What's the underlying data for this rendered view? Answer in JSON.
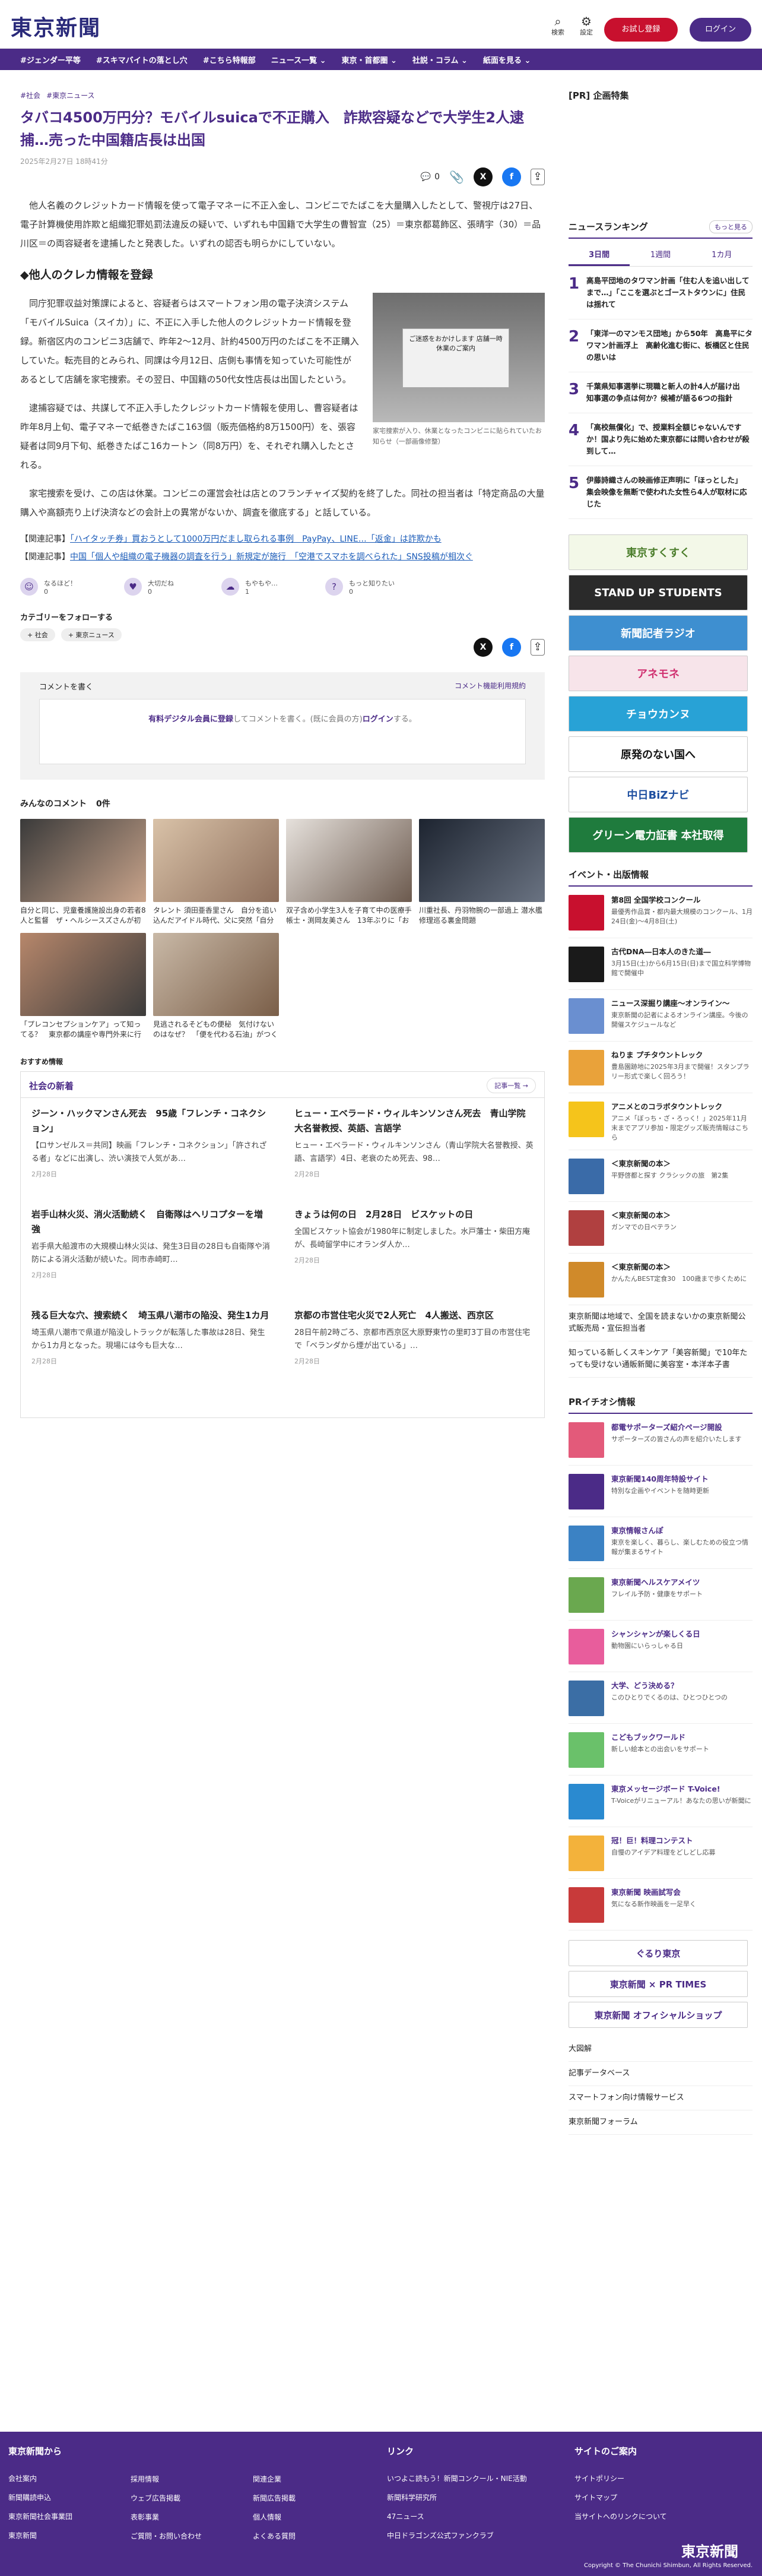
{
  "header": {
    "logo": "東京新聞",
    "search_label": "検索",
    "settings_label": "設定",
    "trial_label": "お試し登録",
    "login_label": "ログイン"
  },
  "nav": [
    "#ジェンダー平等",
    "#スキマバイトの落とし穴",
    "#こちら特報部",
    "ニュース一覧 ⌄",
    "東京・首都圏 ⌄",
    "社説・コラム ⌄",
    "紙面を見る ⌄"
  ],
  "article": {
    "tags": [
      "#社会",
      "#東京ニュース"
    ],
    "title": "タバコ4500万円分？モバイルsuicaで不正購入　詐欺容疑などで大学生2人逮捕…売った中国籍店長は出国",
    "date": "2025年2月27日 18時41分",
    "comment_count": "0",
    "lead": "他人名義のクレジットカード情報を使って電子マネーに不正入金し、コンビニでたばこを大量購入したとして、警視庁は27日、電子計算機使用詐欺と組織犯罪処罰法違反の疑いで、いずれも中国籍で大学生の曹智宣（25）＝東京都葛飾区、張晴宇（30）＝品川区＝の両容疑者を逮捕したと発表した。いずれの認否も明らかにしていない。",
    "h2": "◆他人のクレカ情報を登録",
    "p1": "同庁犯罪収益対策課によると、容疑者らはスマートフォン用の電子決済システム「モバイルSuica（スイカ）」に、不正に入手した他人のクレジットカード情報を登録。新宿区内のコンビニ3店舗で、昨年2～12月、計約4500万円のたばこを不正購入していた。転売目的とみられ、同課は今月12日、店側も事情を知っていた可能性があるとして店舗を家宅捜索。その翌日、中国籍の50代女性店長は出国したという。",
    "p2": "逮捕容疑では、共謀して不正入手したクレジットカード情報を使用し、曹容疑者は昨年8月上旬、電子マネーで紙巻きたばこ163個（販売価格約8万1500円）を、張容疑者は同9月下旬、紙巻きたばこ16カートン（同8万円）を、それぞれ購入したとされる。",
    "p3": "家宅捜索を受け、この店は休業。コンビニの運営会社は店とのフランチャイズ契約を終了した。同社の担当者は「特定商品の大量購入や高額売り上げ決済などの会計上の異常がないか、調査を徹底する」と話している。",
    "figure_sign": "ご迷惑をおかけします 店舗一時休業のご案内",
    "figure_caption": "家宅捜索が入り、休業となったコンビニに貼られていたお知らせ（一部画像修整）",
    "related": [
      {
        "prefix": "【関連記事】",
        "link": "「ハイタッチ券」買おうとして1000万円だまし取られる事例　PayPay、LINE…「返金」は詐欺かも"
      },
      {
        "prefix": "【関連記事】",
        "link": "中国「個人や組織の電子機器の調査を行う」新規定が施行　「空港でスマホを調べられた」SNS投稿が相次ぐ"
      }
    ]
  },
  "reactions": [
    {
      "label": "なるほど！",
      "count": "0"
    },
    {
      "label": "大切だね",
      "count": "0"
    },
    {
      "label": "もやもや…",
      "count": "1"
    },
    {
      "label": "もっと知りたい",
      "count": "0"
    }
  ],
  "follow": {
    "heading": "カテゴリーをフォローする",
    "tags": [
      "+ 社会",
      "+ 東京ニュース"
    ]
  },
  "comment": {
    "heading": "コメントを書く",
    "policy": "コメント機能利用規約",
    "prompt_link": "有料デジタル会員に登録",
    "prompt_rest": "してコメントを書く。(既に会員の方)",
    "login": "ログイン",
    "prompt_end": "する。"
  },
  "everyone_heading": "みんなのコメント",
  "everyone_count": "0件",
  "cards": [
    {
      "t": "自分と同じ、児童養護施設出身の若者8人と監督　ザ・ヘルシースズさんが初監督映画「花束」…",
      "c1": "#3a3a3a",
      "c2": "#c9a48b"
    },
    {
      "t": "タレント 須田亜香里さん　自分を追い込んだアイドル時代、父に突然「自分のこと好きか？」…",
      "c1": "#d9c2a8",
      "c2": "#8d6e5b"
    },
    {
      "t": "双子含め小学生3人を子育て中の医療手帳士・渕岡友美さん　13年ぶりに「おはよう日本」に…",
      "c1": "#e6e1dc",
      "c2": "#6c5a4e"
    },
    {
      "t": "川重社長、丹羽物腕の一部過上 潜水艦修理巡る裏金問題",
      "c1": "#1d2430",
      "c2": "#6a7382"
    },
    {
      "t": "「プレコンセプションケア」って知ってる？　東京都の講座や専門外来に行ってみた",
      "c1": "#b7876b",
      "c2": "#3b3b3b"
    },
    {
      "t": "見逃されるそどもの便秘　気付けないのはなぜ？　「便を代わる石油」がつく書類確実の小児外…",
      "c1": "#c9b9a7",
      "c2": "#7a5e48"
    }
  ],
  "recommend": "おすすめ情報",
  "society": {
    "heading": "社会の新着",
    "more": "記事一覧 →",
    "items": [
      {
        "t": "ジーン・ハックマンさん死去　95歳「フレンチ・コネクション」",
        "d": "【ロサンゼルス＝共同】映画「フレンチ・コネクション」「許されざる者」などに出演し、渋い演技で人気があ…",
        "dt": "2月28日"
      },
      {
        "t": "ヒュー・エベラード・ウィルキンソンさん死去　青山学院大名誉教授、英語、言語学",
        "d": "ヒュー・エベラード・ウィルキンソンさん（青山学院大名誉教授、英語、言語学）4日、老衰のため死去、98…",
        "dt": "2月28日"
      },
      {
        "t": "岩手山林火災、消火活動続く　自衛隊はヘリコプターを増強",
        "d": "岩手県大船渡市の大規模山林火災は、発生3日目の28日も自衛隊や消防による消火活動が続いた。同市赤崎町…",
        "dt": "2月28日"
      },
      {
        "t": "きょうは何の日　2月28日　ビスケットの日",
        "d": "全国ビスケット協会が1980年に制定しました。水戸藩士・柴田方庵が、長崎留学中にオランダ人か…",
        "dt": "2月28日"
      },
      {
        "t": "残る巨大な穴、捜索続く　埼玉県八潮市の陥没、発生1カ月",
        "d": "埼玉県八潮市で県道が陥没しトラックが転落した事故は28日、発生から1カ月となった。現場には今も巨大な…",
        "dt": "2月28日"
      },
      {
        "t": "京都の市営住宅火災で2人死亡　4人搬送、西京区",
        "d": "28日午前2時ごろ、京都市西京区大原野東竹の里町3丁目の市営住宅で「ベランダから煙が出ている」…",
        "dt": "2月28日"
      }
    ]
  },
  "right": {
    "pr_heading": "[PR] 企画特集",
    "ranking_heading": "ニュースランキング",
    "ranking_more": "もっと見る",
    "tabs": [
      "3日間",
      "1週間",
      "1カ月"
    ],
    "ranking": [
      "高島平団地のタワマン計画「住む人を追い出してまで…」「ここを選ぶとゴーストタウンに」住民は揺れて",
      "「東洋一のマンモス団地」から50年　高島平にタワマン計画浮上　高齢化進む街に、板橋区と住民の思いは",
      "千葉県知事選挙に現職と新人の計4人が届け出　知事選の争点は何か？候補が語る6つの指針",
      "「高校無償化」で、授業料全額じゃないんですか！国より先に始めた東京都には問い合わせが殺到して…",
      "伊藤詩織さんの映画修正声明に「ほっとした」　集会映像を無断で使われた女性ら4人が取材に応じた"
    ],
    "banners": [
      {
        "txt": "東京すくすく",
        "bg": "#f3f8e8",
        "fg": "#4a7d2a"
      },
      {
        "txt": "STAND UP STUDENTS",
        "bg": "#2a2a2a",
        "fg": "#fff"
      },
      {
        "txt": "新聞記者ラジオ",
        "bg": "#3e8fd0",
        "fg": "#fff"
      },
      {
        "txt": "アネモネ",
        "bg": "#f7e4ea",
        "fg": "#d03070"
      },
      {
        "txt": "チョウカンヌ",
        "bg": "#28a2d6",
        "fg": "#fff"
      },
      {
        "txt": "原発のない国へ",
        "bg": "#fff",
        "fg": "#111"
      },
      {
        "txt": "中日BiZナビ",
        "bg": "#fff",
        "fg": "#1e4fa0"
      },
      {
        "txt": "グリーン電力証書 本社取得",
        "bg": "#1f7b3d",
        "fg": "#fff"
      }
    ],
    "events_heading": "イベント・出版情報",
    "events": [
      {
        "tt": "第8回 全国学校コンクール",
        "dd": "最優秀作品賞・都内最大規模のコンクール、1月24日(金)～4月8日(土)",
        "c": "#c8102e"
      },
      {
        "tt": "古代DNA―日本人のきた道―",
        "dd": "3月15日(土)から6月15日(日)まで国立科学博物館で開催中",
        "c": "#1a1a1a"
      },
      {
        "tt": "ニュース深掘り講座～オンライン～",
        "dd": "東京新聞の記者によるオンライン講座。今後の開催スケジュールなど",
        "c": "#6a8fd0"
      },
      {
        "tt": "ねりま プチタウントレック",
        "dd": "豊島園跡地に2025年3月まで開催！スタンプラリー形式で楽しく回ろう！",
        "c": "#e9a23a"
      },
      {
        "tt": "アニメとのコラボタウントレック",
        "dd": "アニメ「ぼっち・ざ・ろっく！」2025年11月末までアプリ参加・限定グッズ販売情報はこちら",
        "c": "#f5c41b"
      },
      {
        "tt": "＜東京新聞の本＞",
        "dd": "平野啓都と探す クラシックの旅　第2集",
        "c": "#3a6ba8"
      },
      {
        "tt": "＜東京新聞の本＞",
        "dd": "ガンマでの日ベテラン",
        "c": "#b04040"
      },
      {
        "tt": "＜東京新聞の本＞",
        "dd": "かんたんBEST定食30　100歳まで歩くために",
        "c": "#d08a2a"
      }
    ],
    "links": [
      "東京新聞は地域で、全国を読まないかの東京新聞公式販売局・宣伝担当者",
      "知っている新しくスキンケア「美容新聞」で10年たっても受けない通販新聞に美容室・本洋本子書"
    ],
    "pr2_heading": "PRイチオシ情報",
    "pr2": [
      {
        "tt": "都電サポーターズ紹介ページ開設",
        "dd": "サポーターズの皆さんの声を紹介いたします",
        "c": "#e35a7a"
      },
      {
        "tt": "東京新聞140周年特設サイト",
        "dd": "特別な企画やイベントを随時更新",
        "c": "#4b2b87"
      },
      {
        "tt": "東京情報さんぽ",
        "dd": "東京を楽しく、暮らし、楽しむための役立つ情報が集まるサイト",
        "c": "#3b82c4"
      },
      {
        "tt": "東京新聞ヘルスケアメイツ",
        "dd": "フレイル予防・健康をサポート",
        "c": "#6aa84f"
      },
      {
        "tt": "シャンシャンが楽しくる日",
        "dd": "動物園にいらっしゃる日",
        "c": "#e85d9c"
      },
      {
        "tt": "大学、どう決める？",
        "dd": "このひとりでくるのは、ひとつひとつの",
        "c": "#3b6ea5"
      },
      {
        "tt": "こどもブックワールド",
        "dd": "新しい絵本との出会いをサポート",
        "c": "#6ac16a"
      },
      {
        "tt": "東京メッセージボード T-Voice!",
        "dd": "T-Voiceがリニューアル！あなたの思いが新聞に",
        "c": "#2a8ad0"
      },
      {
        "tt": "冠！巨！料理コンテスト",
        "dd": "自慢のアイデア料理をどしどし応募",
        "c": "#f3b23b"
      },
      {
        "tt": "東京新聞 映画試写会",
        "dd": "気になる新作映画を一足早く",
        "c": "#c83a3a"
      }
    ],
    "bottom_banners": [
      "ぐるり東京",
      "東京新聞 × PR TIMES",
      "東京新聞 オフィシャルショップ"
    ],
    "footer_links": [
      "大図解",
      "記事データベース",
      "スマートフォン向け情報サービス",
      "東京新聞フォーラム"
    ]
  },
  "footer": {
    "col1_heading": "東京新聞から",
    "col1": [
      "会社案内",
      "新聞購読申込",
      "東京新聞社会事業団",
      "東京新聞"
    ],
    "col2": [
      "採用情報",
      "ウェブ広告掲載",
      "表彰事業",
      "ご質問・お問い合わせ"
    ],
    "col3": [
      "関連企業",
      "新聞広告掲載",
      "個人情報",
      "よくある質問"
    ],
    "col4_heading": "リンク",
    "col4": [
      "いつよこ読もう！新聞コンクール・NIE活動",
      "新聞科学研究所",
      "47ニュース",
      "中日ドラゴンズ公式ファンクラブ"
    ],
    "col5_heading": "サイトのご案内",
    "col5": [
      "サイトポリシー",
      "サイトマップ",
      "当サイトへのリンクについて"
    ],
    "logo": "東京新聞",
    "copyright": "Copyright © The Chunichi Shimbun, All Rights Reserved."
  }
}
